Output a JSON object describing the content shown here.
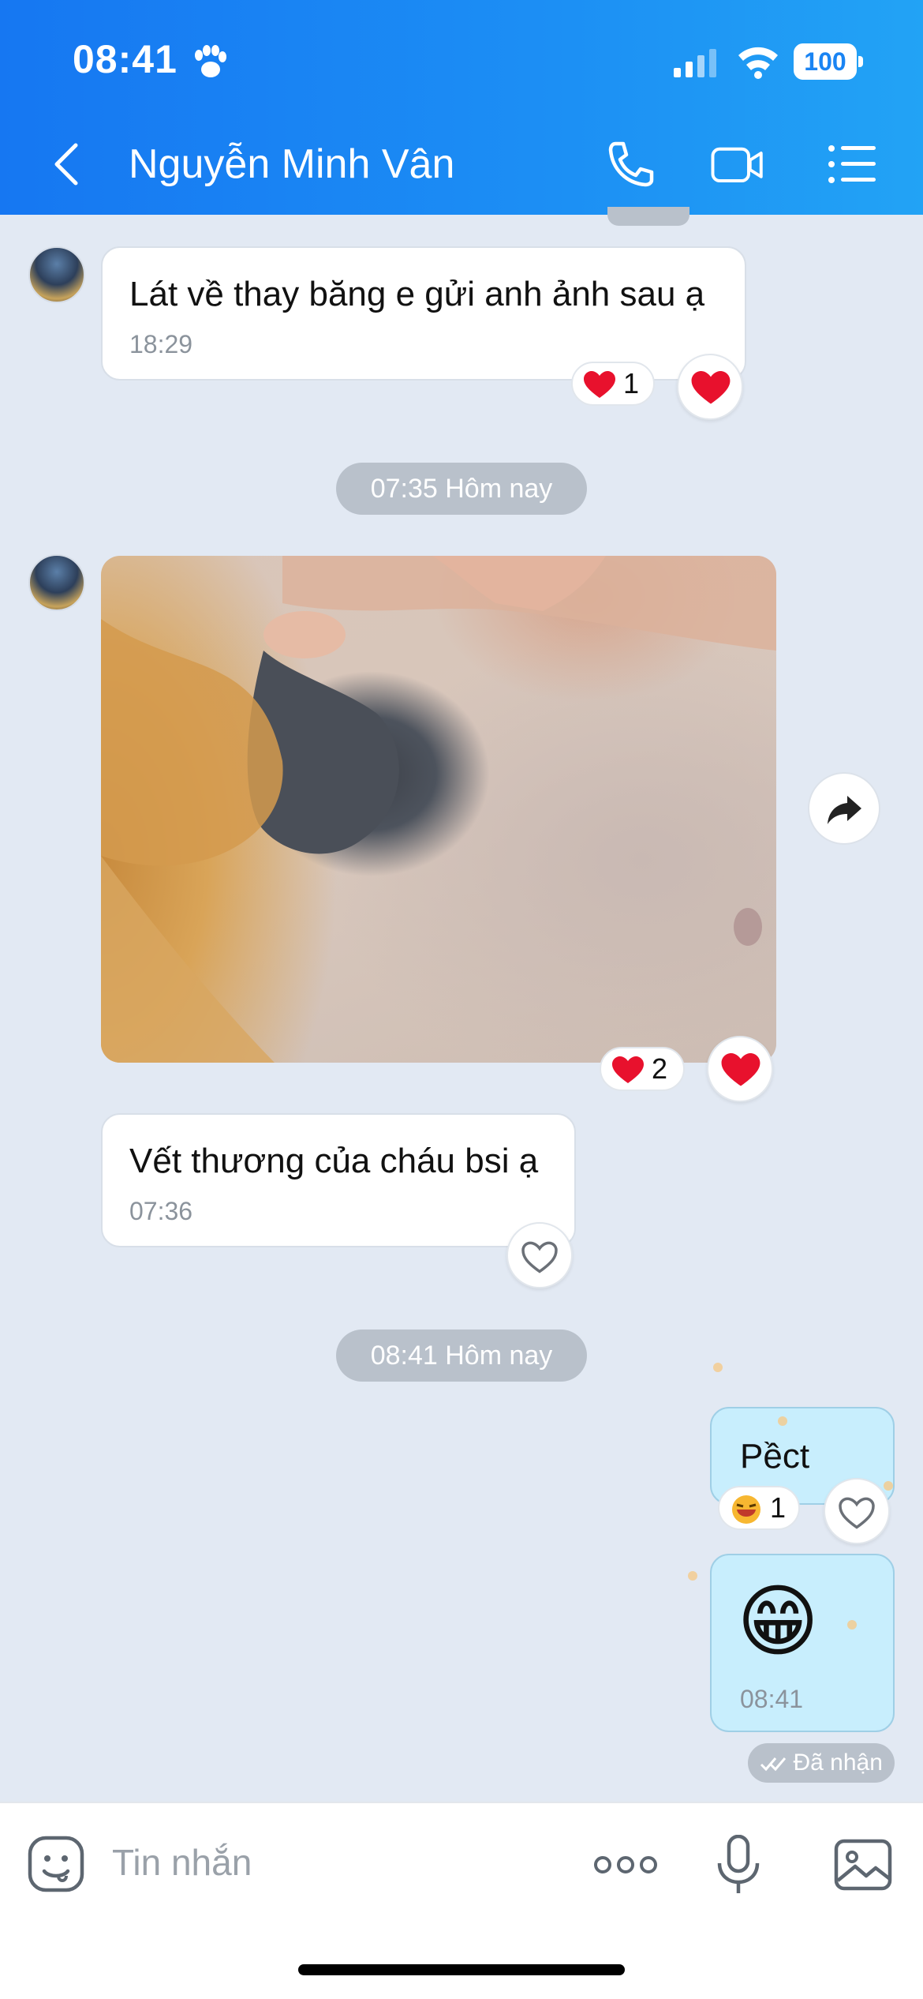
{
  "status_bar": {
    "time": "08:41",
    "battery": "100"
  },
  "header": {
    "contact_name": "Nguyễn Minh Vân"
  },
  "messages": [
    {
      "text": "Lát về thay băng e gửi anh ảnh sau ạ",
      "time": "18:29",
      "reaction_count": "1"
    },
    {
      "separator": "07:35 Hôm nay"
    },
    {
      "type": "image",
      "reaction_count": "2"
    },
    {
      "text": "Vết thương của cháu bsi ạ",
      "time": "07:36"
    },
    {
      "separator": "08:41 Hôm nay"
    },
    {
      "text": "Pềct",
      "reaction_count": "1"
    },
    {
      "emoji": "😁",
      "time": "08:41"
    }
  ],
  "seen_label": "Đã nhận",
  "input": {
    "placeholder": "Tin nhắn"
  },
  "colors": {
    "header": "#1c8ff4",
    "my_bubble": "#c8eefd",
    "heart": "#e8112d"
  }
}
